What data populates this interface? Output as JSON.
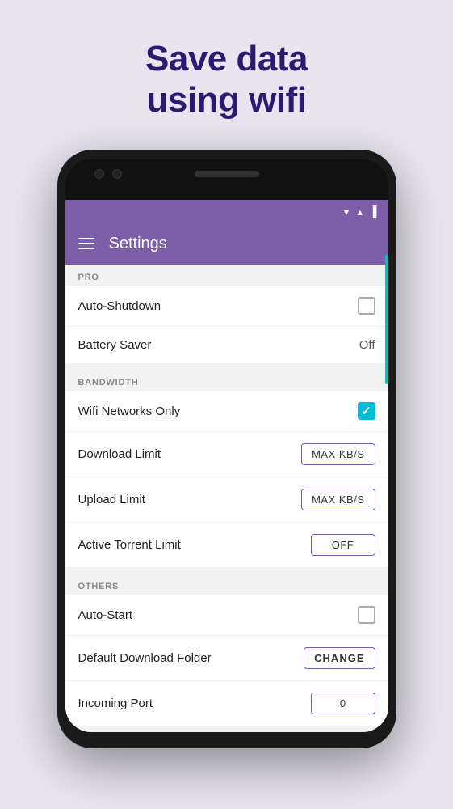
{
  "hero": {
    "line1": "Save data",
    "line2": "using wifi"
  },
  "app_bar": {
    "title": "Settings"
  },
  "sections": {
    "pro": {
      "header": "PRO",
      "rows": [
        {
          "label": "Auto-Shutdown",
          "control": "checkbox_empty"
        },
        {
          "label": "Battery Saver",
          "control": "value",
          "value": "Off"
        }
      ]
    },
    "bandwidth": {
      "header": "BANDWIDTH",
      "rows": [
        {
          "label": "Wifi Networks Only",
          "control": "checkbox_checked"
        },
        {
          "label": "Download Limit",
          "control": "button",
          "value": "MAX KB/S"
        },
        {
          "label": "Upload Limit",
          "control": "button",
          "value": "MAX KB/S"
        },
        {
          "label": "Active Torrent Limit",
          "control": "button",
          "value": "OFF"
        }
      ]
    },
    "others": {
      "header": "OTHERS",
      "rows": [
        {
          "label": "Auto-Start",
          "control": "checkbox_empty"
        },
        {
          "label": "Default Download Folder",
          "control": "change_button",
          "value": "CHANGE"
        },
        {
          "label": "Incoming Port",
          "control": "port_value",
          "value": "0"
        }
      ]
    }
  },
  "icons": {
    "hamburger": "≡",
    "checkmark": "✓",
    "wifi": "▼",
    "signal": "▲",
    "battery": "▐"
  }
}
